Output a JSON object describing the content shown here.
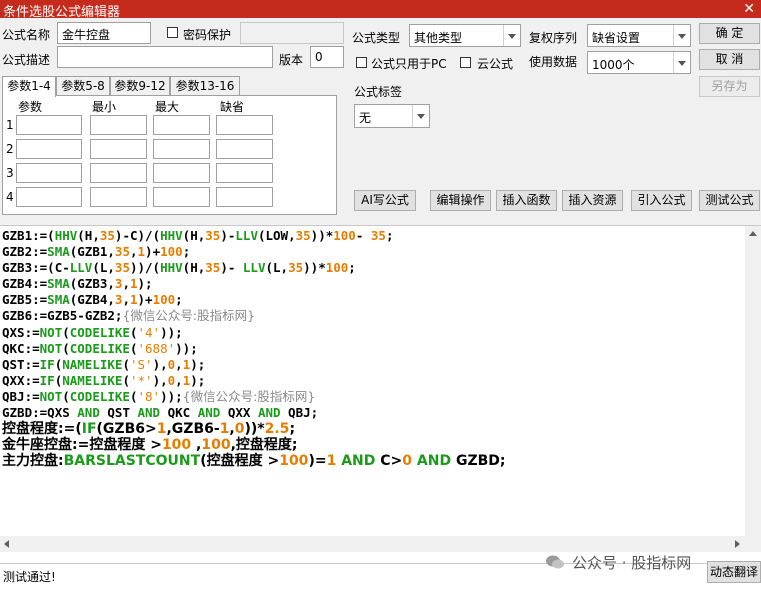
{
  "window": {
    "title": "条件选股公式编辑器",
    "close_glyph": "✕"
  },
  "form": {
    "name_label": "公式名称",
    "name_value": "金牛控盘",
    "password_label": "密码保护",
    "desc_label": "公式描述",
    "version_label": "版本",
    "version_value": "0",
    "type_label": "公式类型",
    "type_value": "其他类型",
    "restore_label": "复权序列",
    "restore_value": "缺省设置",
    "pc_only_label": "公式只用于PC",
    "cloud_label": "云公式",
    "data_label": "使用数据",
    "data_value": "1000个",
    "tag_label": "公式标签",
    "tag_value": "无"
  },
  "buttons": {
    "ok": "确  定",
    "cancel": "取  消",
    "save_as": "另存为",
    "ai_write": "AI写公式",
    "edit_op": "编辑操作",
    "insert_func": "插入函数",
    "insert_res": "插入资源",
    "import_formula": "引入公式",
    "test_formula": "测试公式",
    "dynamic_translate": "动态翻译"
  },
  "tabs": [
    "参数1-4",
    "参数5-8",
    "参数9-12",
    "参数13-16"
  ],
  "param_headers": [
    "参数",
    "最小",
    "最大",
    "缺省"
  ],
  "param_rows": [
    "1",
    "2",
    "3",
    "4"
  ],
  "code_lines": [
    "GZB1:=(HHV(H,35)-C)/(HHV(H,35)-LLV(LOW,35))*100- 35;",
    "GZB2:=SMA(GZB1,35,1)+100;",
    "GZB3:=(C-LLV(L,35))/(HHV(H,35)- LLV(L,35))*100;",
    "GZB4:=SMA(GZB3,3,1);",
    "GZB5:=SMA(GZB4,3,1)+100;",
    "GZB6:=GZB5-GZB2;{微信公众号:股指标网}",
    "QXS:=NOT(CODELIKE('4'));",
    "QKC:=NOT(CODELIKE('688'));",
    "QST:=IF(NAMELIKE('S'),0,1);",
    "QXX:=IF(NAMELIKE('*'),0,1);",
    "QBJ:=NOT(CODELIKE('8'));{微信公众号:股指标网}",
    "GZBD:=QXS AND QST AND QKC AND QXX AND QBJ;",
    "控盘程度:=(IF(GZB6>1,GZB6-1,0))*2.5;",
    "金牛座控盘:=控盘程度 >100 ,100,控盘程度;",
    "主力控盘:BARSLASTCOUNT(控盘程度 >100)=1 AND C>0 AND GZBD;"
  ],
  "status": "测试通过!",
  "watermark": "公众号 · 股指标网"
}
